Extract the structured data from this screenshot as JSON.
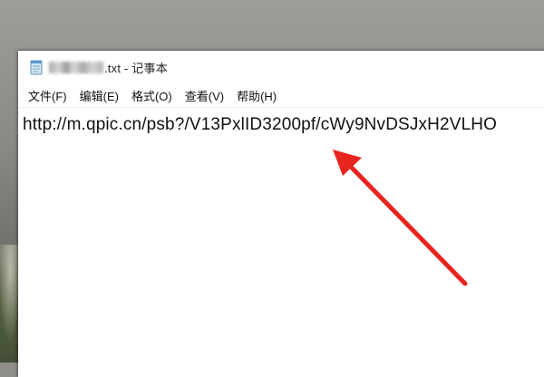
{
  "window": {
    "title_suffix": ".txt - 记事本"
  },
  "menu": {
    "items": [
      {
        "label": "文件(F)"
      },
      {
        "label": "编辑(E)"
      },
      {
        "label": "格式(O)"
      },
      {
        "label": "查看(V)"
      },
      {
        "label": "帮助(H)"
      }
    ]
  },
  "editor": {
    "content": "http://m.qpic.cn/psb?/V13PxlID3200pf/cWy9NvDSJxH2VLHO"
  },
  "annotation": {
    "arrow_color": "#e8241e",
    "arrow_icon": "red-arrow-icon"
  }
}
